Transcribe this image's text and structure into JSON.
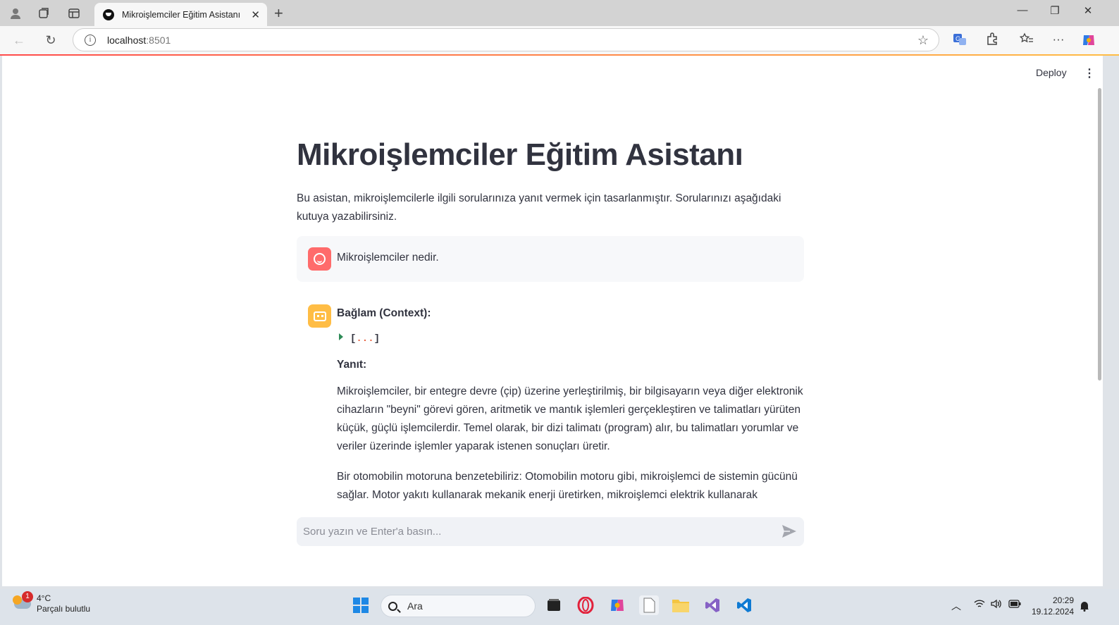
{
  "browser": {
    "tab_title": "Mikroişlemciler Eğitim Asistanı",
    "url_host": "localhost",
    "url_port": ":8501"
  },
  "app": {
    "deploy_label": "Deploy",
    "title": "Mikroişlemciler Eğitim Asistanı",
    "intro": "Bu asistan, mikroişlemcilerle ilgili sorularınıza yanıt vermek için tasarlanmıştır. Sorularınızı aşağıdaki kutuya yazabilirsiniz.",
    "user_message": "Mikroişlemciler nedir.",
    "context_heading": "Bağlam (Context):",
    "context_open": "[",
    "context_dots": "...",
    "context_close": "]",
    "answer_heading": "Yanıt:",
    "answer_p1": "Mikroişlemciler, bir entegre devre (çip) üzerine yerleştirilmiş, bir bilgisayarın veya diğer elektronik cihazların \"beyni\" görevi gören, aritmetik ve mantık işlemleri gerçekleştiren ve talimatları yürüten küçük, güçlü işlemcilerdir. Temel olarak, bir dizi talimatı (program) alır, bu talimatları yorumlar ve veriler üzerinde işlemler yaparak istenen sonuçları üretir.",
    "answer_p2": "Bir otomobilin motoruna benzetebiliriz: Otomobilin motoru gibi, mikroişlemci de sistemin gücünü sağlar. Motor yakıtı kullanarak mekanik enerji üretirken, mikroişlemci elektrik kullanarak",
    "input_placeholder": "Soru yazın ve Enter'a basın..."
  },
  "taskbar": {
    "weather_temp": "4°C",
    "weather_desc": "Parçalı bulutlu",
    "weather_badge": "1",
    "search_label": "Ara",
    "time": "20:29",
    "date": "19.12.2024"
  },
  "colors": {
    "accent": "#ff4b4b",
    "bot_avatar": "#ffbd45",
    "text": "#31333f"
  }
}
